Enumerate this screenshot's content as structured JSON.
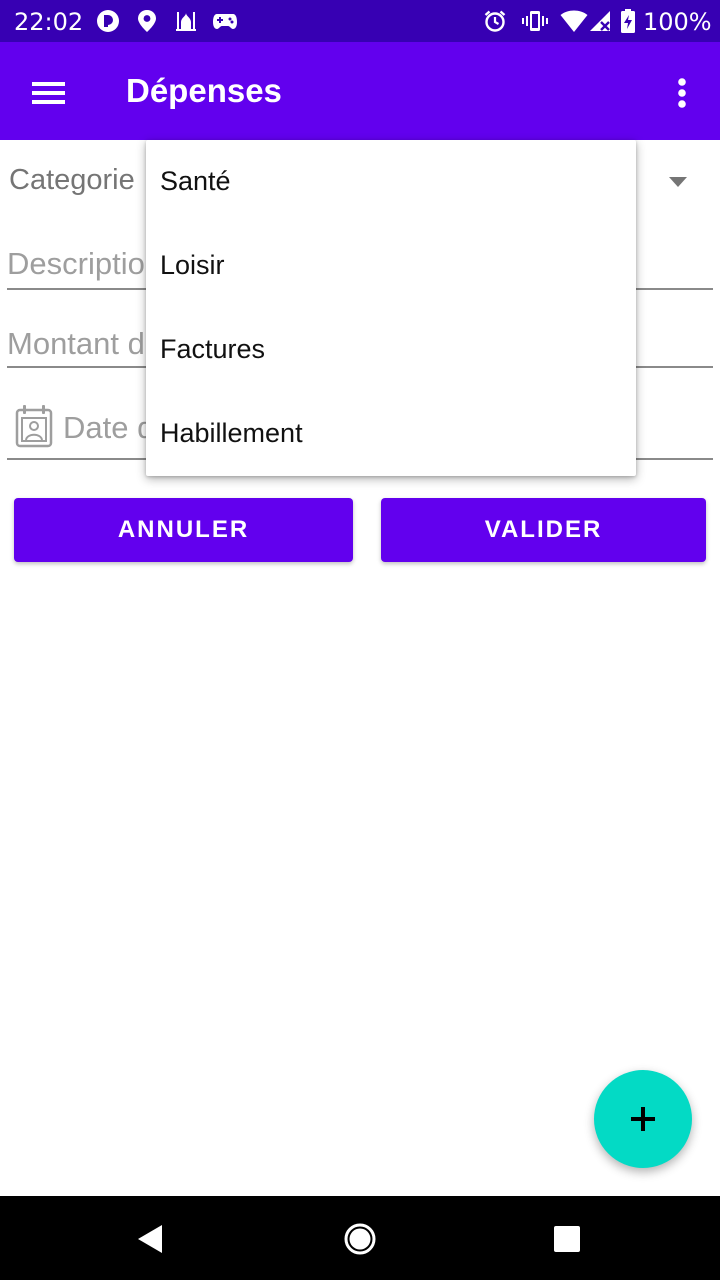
{
  "status_bar": {
    "time": "22:02",
    "battery": "100%",
    "icons": [
      "app-notification-icon",
      "location-icon",
      "mosque-icon",
      "game-controller-icon",
      "alarm-icon",
      "vibrate-icon",
      "wifi-icon",
      "signal-icon",
      "battery-icon"
    ]
  },
  "app_bar": {
    "title": "Dépenses",
    "menu_icon": "hamburger-menu-icon",
    "overflow_icon": "more-vert-icon"
  },
  "form": {
    "category_label": "Categorie",
    "description_placeholder": "Description",
    "amount_placeholder": "Montant de la dépense",
    "date_placeholder": "Date de la dépense",
    "cancel_label": "ANNULER",
    "validate_label": "VALIDER"
  },
  "dropdown": {
    "items": [
      "Santé",
      "Loisir",
      "Factures",
      "Habillement"
    ]
  },
  "fab": {
    "icon": "plus-icon"
  },
  "nav_bar": {
    "icons": [
      "back-icon",
      "home-icon",
      "recents-icon"
    ]
  },
  "colors": {
    "status_bar": "#3700b3",
    "primary": "#6200ee",
    "accent": "#03dac5"
  }
}
